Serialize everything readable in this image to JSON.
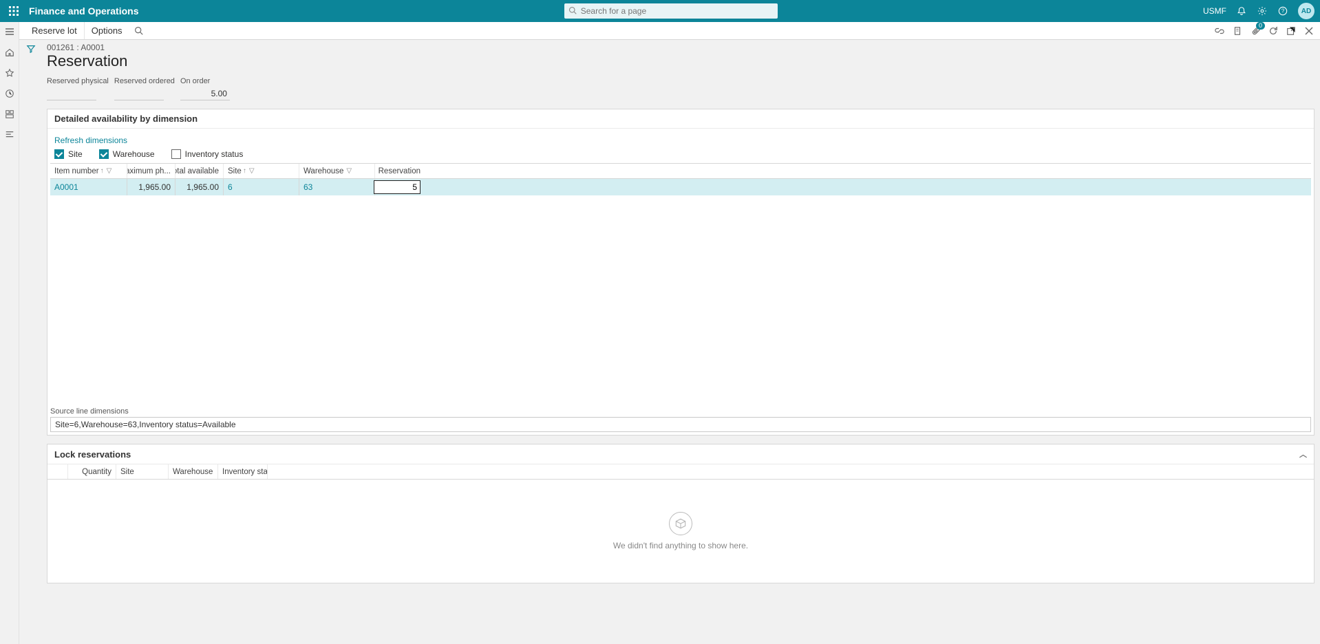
{
  "app_bar": {
    "title": "Finance and Operations",
    "search_placeholder": "Search for a page",
    "legal_entity": "USMF",
    "avatar": "AD"
  },
  "action_pane": {
    "reserve_lot": "Reserve lot",
    "options": "Options",
    "attachments_count": "0"
  },
  "page": {
    "breadcrumb": "001261 : A0001",
    "title": "Reservation",
    "fields": {
      "reserved_physical_label": "Reserved physical",
      "reserved_physical_value": "",
      "reserved_ordered_label": "Reserved ordered",
      "reserved_ordered_value": "",
      "on_order_label": "On order",
      "on_order_value": "5.00"
    }
  },
  "detail_panel": {
    "title": "Detailed availability by dimension",
    "refresh_link": "Refresh dimensions",
    "dim_site": "Site",
    "dim_warehouse": "Warehouse",
    "dim_inv_status": "Inventory status",
    "columns": {
      "item": "Item number",
      "max": "Maximum ph...",
      "total": "Total available",
      "site": "Site",
      "warehouse": "Warehouse",
      "reservation": "Reservation"
    },
    "row": {
      "item": "A0001",
      "max": "1,965.00",
      "total": "1,965.00",
      "site": "6",
      "warehouse": "63",
      "reservation": "5"
    },
    "source_dims_label": "Source line dimensions",
    "source_dims_value": "Site=6,Warehouse=63,Inventory status=Available"
  },
  "lock_panel": {
    "title": "Lock reservations",
    "columns": {
      "qty": "Quantity",
      "site": "Site",
      "warehouse": "Warehouse",
      "inv_status": "Inventory sta..."
    },
    "empty_text": "We didn't find anything to show here."
  }
}
